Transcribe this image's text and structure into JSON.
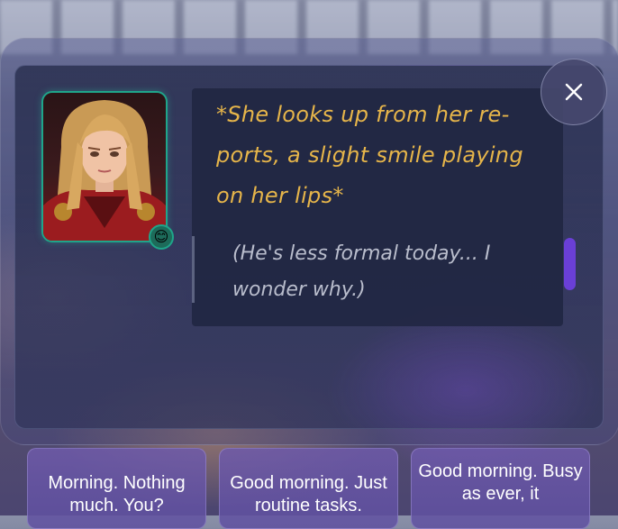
{
  "dialogue": {
    "narration": "*She looks up from her re-ports, a slight smile playing on her lips*",
    "thought": "(He's less formal today... I wonder why.)"
  },
  "character": {
    "portrait_icon": "character-portrait",
    "mood_emoji": "😊"
  },
  "close_button": {
    "icon": "close-icon",
    "glyph": "✕"
  },
  "choices": [
    {
      "label": "Morning. Nothing much. You?"
    },
    {
      "label": "Good morning. Just routine tasks."
    },
    {
      "label": "Good morning. Busy as ever, it"
    }
  ],
  "colors": {
    "narration": "#e6b54a",
    "thought": "#b9bdcc",
    "portrait_border": "#1fa58a",
    "scroll_thumb": "#6a3fd6",
    "choice_bg": "#6e5aaa"
  }
}
